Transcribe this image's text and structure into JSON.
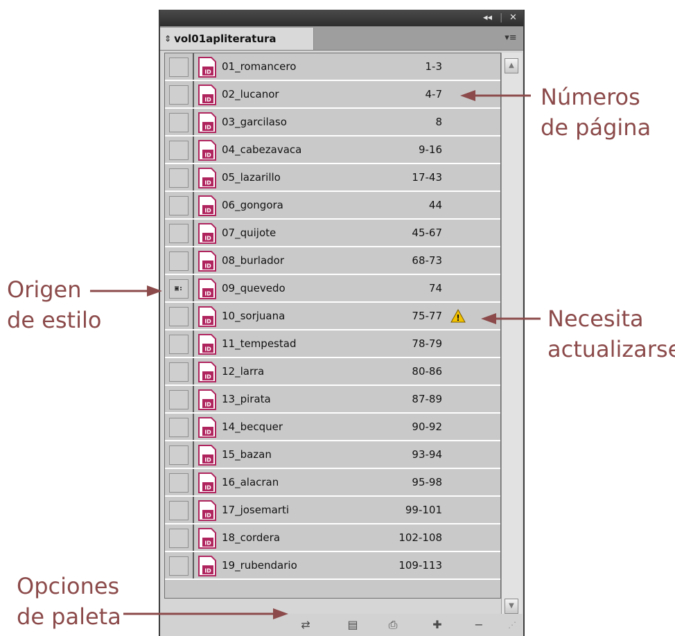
{
  "window": {
    "collapse_label": "◂◂",
    "close_label": "✕"
  },
  "tab": {
    "label": "vol01apliteratura",
    "reorder_glyph": "⇕"
  },
  "menu_button": {
    "glyph": "▾≡"
  },
  "documents": [
    {
      "name": "01_romancero",
      "pages": "1-3"
    },
    {
      "name": "02_lucanor",
      "pages": "4-7"
    },
    {
      "name": "03_garcilaso",
      "pages": "8"
    },
    {
      "name": "04_cabezavaca",
      "pages": "9-16"
    },
    {
      "name": "05_lazarillo",
      "pages": "17-43"
    },
    {
      "name": "06_gongora",
      "pages": "44"
    },
    {
      "name": "07_quijote",
      "pages": "45-67"
    },
    {
      "name": "08_burlador",
      "pages": "68-73"
    },
    {
      "name": "09_quevedo",
      "pages": "74",
      "style_source": true,
      "style_source_glyph": "▣:"
    },
    {
      "name": "10_sorjuana",
      "pages": "75-77",
      "needs_update": true
    },
    {
      "name": "11_tempestad",
      "pages": "78-79"
    },
    {
      "name": "12_larra",
      "pages": "80-86"
    },
    {
      "name": "13_pirata",
      "pages": "87-89"
    },
    {
      "name": "14_becquer",
      "pages": "90-92"
    },
    {
      "name": "15_bazan",
      "pages": "93-94"
    },
    {
      "name": "16_alacran",
      "pages": "95-98"
    },
    {
      "name": "17_josemarti",
      "pages": "99-101"
    },
    {
      "name": "18_cordera",
      "pages": "102-108"
    },
    {
      "name": "19_rubendario",
      "pages": "109-113"
    }
  ],
  "doc_icon_label": "ID",
  "scroll": {
    "up_glyph": "▲",
    "down_glyph": "▼"
  },
  "toolbar": {
    "sync_icon": "⇄",
    "save_icon": "▤",
    "print_icon": "⎙",
    "add_icon": "✚",
    "remove_icon": "−",
    "resize_icon": "⋰"
  },
  "annotations": {
    "page_numbers_line1": "Números",
    "page_numbers_line2": "de página",
    "style_source_line1": "Origen",
    "style_source_line2": "de estilo",
    "needs_update_line1": "Necesita",
    "needs_update_line2": "actualizarse",
    "palette_options_line1": "Opciones",
    "palette_options_line2": "de paleta"
  },
  "colors": {
    "annotation": "#8c4a4a",
    "doc_icon": "#b0245e",
    "warning": "#f2c200"
  }
}
